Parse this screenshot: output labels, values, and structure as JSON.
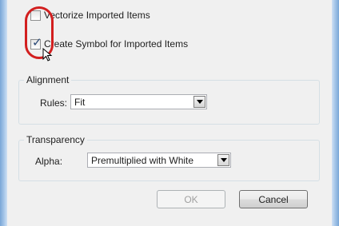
{
  "options": {
    "vectorize": {
      "label": "Vectorize Imported Items",
      "checked": false
    },
    "create_symbol": {
      "label": "Create Symbol for Imported Items",
      "checked": true
    }
  },
  "alignment": {
    "title": "Alignment",
    "rules_label": "Rules:",
    "rules_value": "Fit"
  },
  "transparency": {
    "title": "Transparency",
    "alpha_label": "Alpha:",
    "alpha_value": "Premultiplied with White"
  },
  "buttons": {
    "ok_label": "OK",
    "ok_enabled": false,
    "cancel_label": "Cancel"
  },
  "icons": {
    "check_mark": "check-icon",
    "dropdown": "chevron-down-icon",
    "pointer": "mouse-pointer-icon"
  },
  "colors": {
    "highlight_ring": "#d21f1f",
    "window_frame": "#a9c8ea",
    "dialog_bg": "#f0f0f0"
  }
}
